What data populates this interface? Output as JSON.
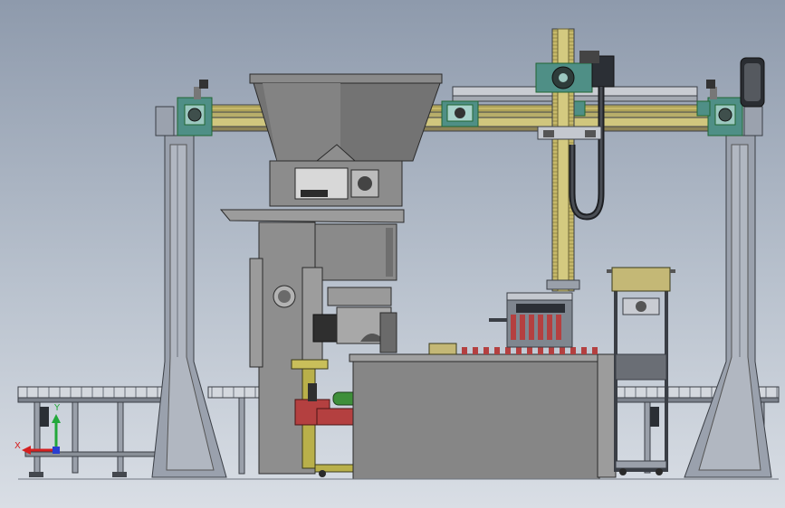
{
  "viewport": {
    "background_top": "#8e9aac",
    "background_bottom": "#d9dee5"
  },
  "triad": {
    "x_label": "X",
    "y_label": "Y",
    "x_color": "#d42020",
    "y_color": "#22a83a",
    "z_color": "#2a3fd0"
  },
  "colors": {
    "frame_steel": "#8f96a3",
    "rail_yellow": "#c7b96a",
    "bearing_teal": "#4f8f86",
    "hopper_grey": "#707070",
    "cabinet_grey": "#8a8a8a",
    "gripper_red": "#b44040",
    "cylinder_green": "#3e8f3a",
    "lift_yellow": "#b9b04a"
  }
}
